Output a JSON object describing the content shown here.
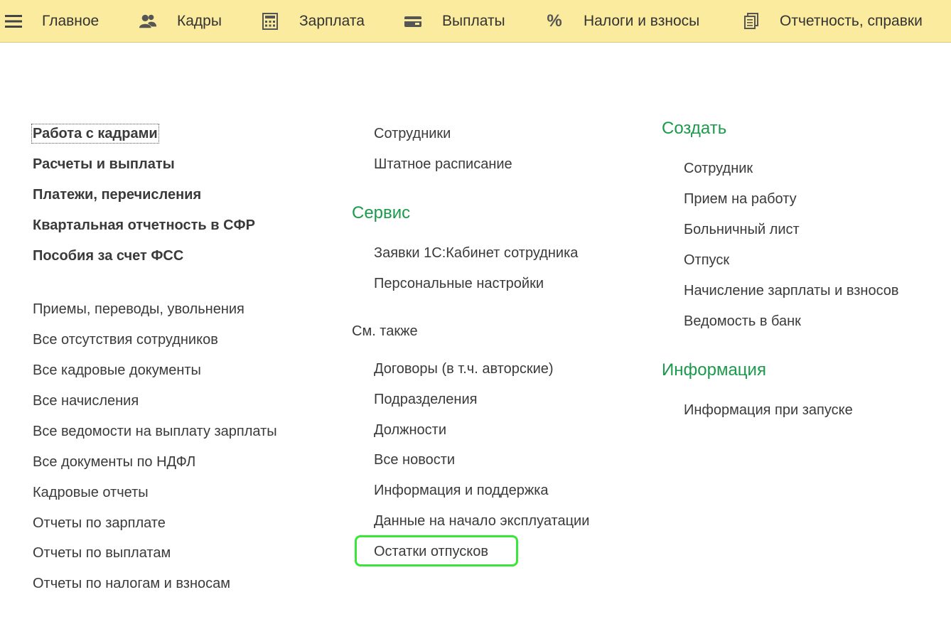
{
  "topbar": {
    "items": [
      {
        "label": "Главное",
        "icon": "hamburger-icon"
      },
      {
        "label": "Кадры",
        "icon": "people-icon"
      },
      {
        "label": "Зарплата",
        "icon": "calculator-icon"
      },
      {
        "label": "Выплаты",
        "icon": "wallet-icon"
      },
      {
        "label": "Налоги и взносы",
        "icon": "percent-icon"
      },
      {
        "label": "Отчетность, справки",
        "icon": "documents-icon"
      }
    ]
  },
  "left": {
    "bold_links": [
      "Работа с кадрами",
      "Расчеты и выплаты",
      "Платежи, перечисления",
      "Квартальная отчетность в СФР",
      "Пособия за счет ФСС"
    ],
    "links": [
      "Приемы, переводы, увольнения",
      "Все отсутствия сотрудников",
      "Все кадровые документы",
      "Все начисления",
      "Все ведомости на выплату зарплаты",
      "Все документы по НДФЛ",
      "Кадровые отчеты",
      "Отчеты по зарплате",
      "Отчеты по выплатам",
      "Отчеты по налогам и взносам"
    ]
  },
  "middle": {
    "top_links": [
      "Сотрудники",
      "Штатное расписание"
    ],
    "service_title": "Сервис",
    "service_links": [
      "Заявки 1С:Кабинет сотрудника",
      "Персональные настройки"
    ],
    "see_also_title": "См. также",
    "see_also_links": [
      "Договоры (в т.ч. авторские)",
      "Подразделения",
      "Должности",
      "Все новости",
      "Информация и поддержка",
      "Данные на начало эксплуатации",
      "Остатки отпусков"
    ]
  },
  "right": {
    "create_title": "Создать",
    "create_links": [
      "Сотрудник",
      "Прием на работу",
      "Больничный лист",
      "Отпуск",
      "Начисление зарплаты и взносов",
      "Ведомость в банк"
    ],
    "info_title": "Информация",
    "info_links": [
      "Информация при запуске"
    ]
  },
  "colors": {
    "topbar_bg": "#fbeb9e",
    "section_title": "#1b9a4b",
    "highlight": "#39e639"
  }
}
